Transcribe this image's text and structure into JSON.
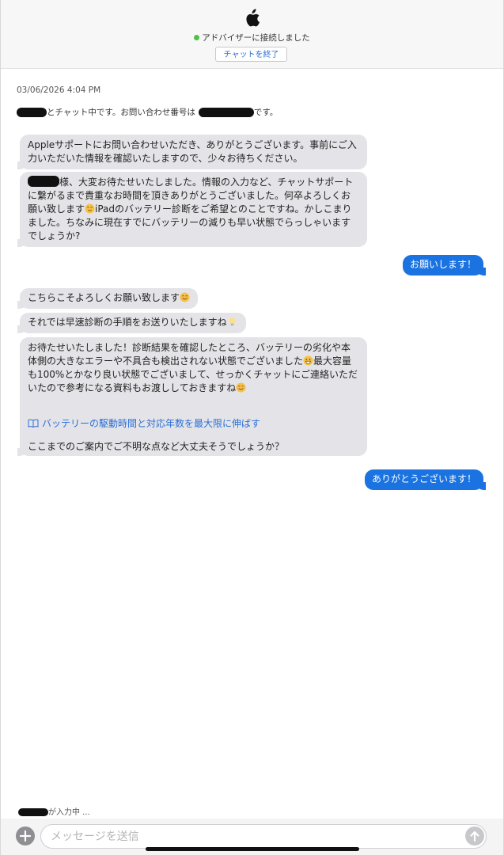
{
  "header": {
    "logo_icon": "apple-logo-icon",
    "status_text": "アドバイザーに接続しました",
    "status_color": "#4cc24a",
    "end_chat_label": "チャットを終了"
  },
  "transcript": {
    "timestamp": "03/06/2026 4:04 PM",
    "intro_middle": "とチャット中です。お問い合わせ番号は",
    "intro_end": "です。"
  },
  "messages": {
    "m1": "Appleサポートにお問い合わせいただき、ありがとうございます。事前にご入力いただいた情報を確認いたしますので、少々お待ちください。",
    "m2_a": "様、大変お待たせいたしました。情報の入力など、チャットサポートに繋がるまで貴重なお時間を頂きありがとうございました。何卒よろしくお願い致します",
    "m2_b": "iPadのバッテリー診断をご希望とのことですね。かしこまりました。ちなみに現在すでにバッテリーの減りも早い状態でらっしゃいますでしょうか?",
    "u1": "お願いします！",
    "m3": "こちらこそよろしくお願い致します",
    "m4": "それでは早速診断の手順をお送りいたしますね",
    "m5_a": "お待たせいたしました！診断結果を確認したところ、バッテリーの劣化や本体側の大きなエラーや不具合も検出されない状態でございました",
    "m5_b": "最大容量も100%とかなり良い状態でございまして、せっかくチャットにご連絡いただいたので参考になる資料もお渡ししておきますね",
    "m5_link": "バッテリーの駆動時間と対応年数を最大限に伸ばす",
    "m5_c": "ここまでのご案内でご不明な点など大丈夫そうでしょうか？",
    "u2": "ありがとうございます！"
  },
  "footer": {
    "typing_text": "が入力中 ...",
    "input_placeholder": "メッセージを送信",
    "plus_icon": "plus-icon",
    "send_icon": "send-arrow-icon"
  },
  "colors": {
    "incoming_bubble": "#e4e4e8",
    "outgoing_bubble": "#1a73e0",
    "link": "#2a6fd6"
  }
}
